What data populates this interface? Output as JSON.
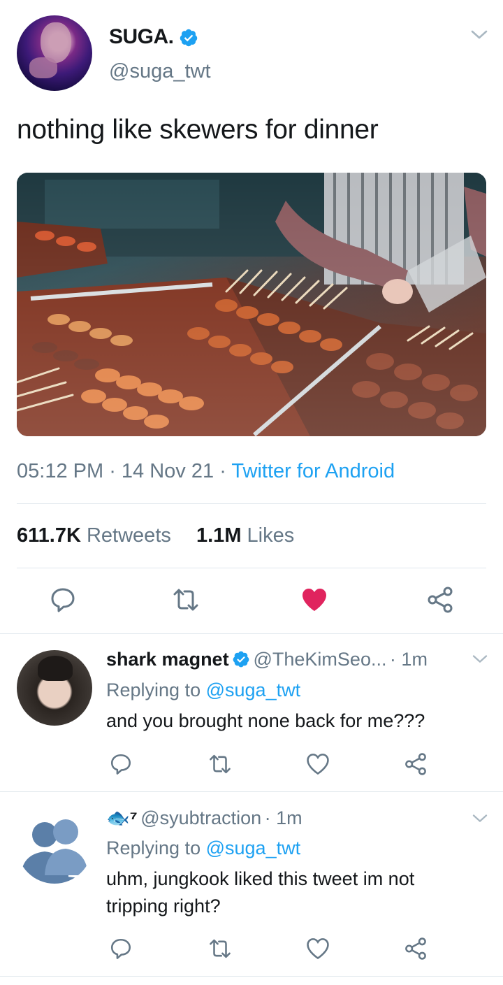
{
  "tweet": {
    "display_name": "SUGA.",
    "handle": "@suga_twt",
    "text": "nothing like skewers for dinner",
    "time": "05:12 PM",
    "date": "14 Nov 21",
    "source": "Twitter for Android",
    "retweets_count": "611.7K",
    "retweets_label": "Retweets",
    "likes_count": "1.1M",
    "likes_label": "Likes",
    "liked": true
  },
  "replies": [
    {
      "display_name": "shark magnet",
      "handle": "@TheKimSeo...",
      "time": "1m",
      "replying_prefix": "Replying to",
      "replying_to": "@suga_twt",
      "text": "and you brought none back for me???"
    },
    {
      "display_name": "🐟⁷",
      "handle": "@syubtraction",
      "time": "1m",
      "replying_prefix": "Replying to",
      "replying_to": "@suga_twt",
      "text_line1": "uhm, jungkook liked this tweet im not",
      "text_line2": "tripping right?"
    }
  ],
  "colors": {
    "accent": "#1da1f2",
    "like": "#e0245e",
    "secondary_text": "#657786",
    "divider": "#e1e8ed"
  }
}
